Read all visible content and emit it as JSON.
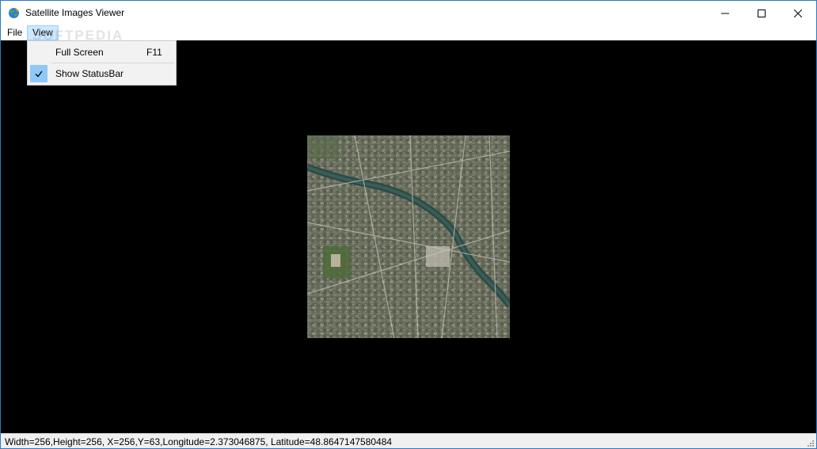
{
  "window": {
    "title": "Satellite Images Viewer",
    "icon": "globe-icon"
  },
  "menubar": {
    "file": "File",
    "view": "View"
  },
  "view_menu": {
    "items": [
      {
        "label": "Full Screen",
        "shortcut": "F11",
        "checked": false
      },
      {
        "label": "Show StatusBar",
        "shortcut": "",
        "checked": true
      }
    ]
  },
  "watermark": "SOFTPEDIA",
  "statusbar": {
    "text": "Width=256,Height=256,  X=256,Y=63,Longitude=2.373046875, Latitude=48.8647147580484"
  },
  "colors": {
    "viewport_bg": "#000000",
    "menu_highlight": "#cce8ff",
    "check_bg": "#90c8f6",
    "window_border": "#2b79c9"
  }
}
